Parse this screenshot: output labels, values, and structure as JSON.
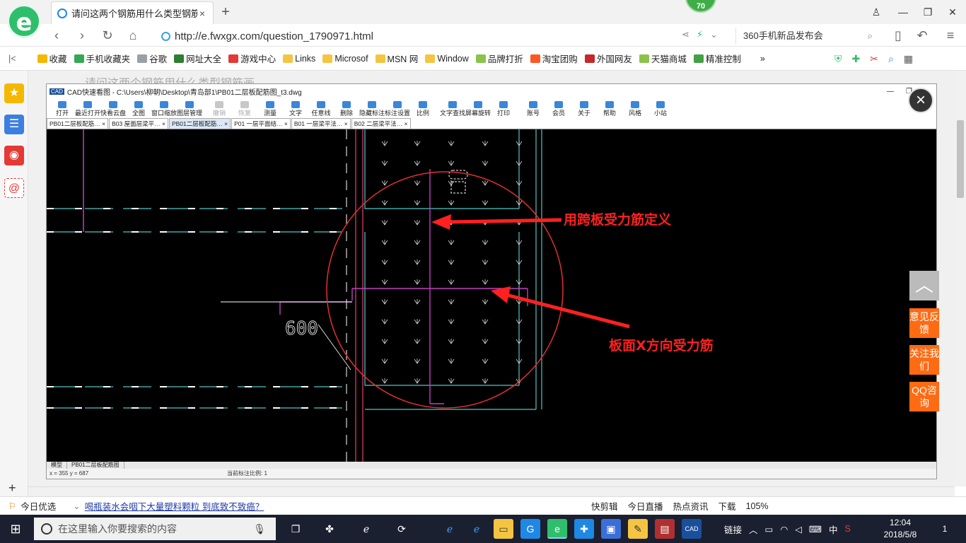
{
  "browser": {
    "logo": "e",
    "tab_title": "请问这两个钢筋用什么类型钢筋画",
    "tab_close": "×",
    "new_tab": "+",
    "badge": "70",
    "url": "http://e.fwxgx.com/question_1790971.html",
    "search_text": "360手机新品发布会",
    "bookmarks": [
      {
        "label": "收藏",
        "color": "#f5b800"
      },
      {
        "label": "手机收藏夹",
        "color": "#34a853"
      },
      {
        "label": "谷歌",
        "color": "#9aa0a6"
      },
      {
        "label": "网址大全",
        "color": "#2e7d32"
      },
      {
        "label": "游戏中心",
        "color": "#e53935"
      },
      {
        "label": "Links",
        "color": "#f4c542"
      },
      {
        "label": "Microsof",
        "color": "#f4c542"
      },
      {
        "label": "MSN 网",
        "color": "#f4c542"
      },
      {
        "label": "Window",
        "color": "#f4c542"
      },
      {
        "label": "品牌打折",
        "color": "#8bc34a"
      },
      {
        "label": "淘宝团购",
        "color": "#ff5722"
      },
      {
        "label": "外国网友",
        "color": "#c62828"
      },
      {
        "label": "天猫商城",
        "color": "#8bc34a"
      },
      {
        "label": "精准控制",
        "color": "#43a047"
      },
      {
        "label": "»",
        "color": "#ffffff"
      }
    ],
    "page_partial_text": "请问这两个钢筋用什么类型钢筋画"
  },
  "viewer": {
    "app_logo": "CAD",
    "title": "CAD快速看图 - C:\\Users\\柳朝\\Desktop\\青岛部1\\PB01二层板配筋图_t3.dwg",
    "toolbar": [
      {
        "label": "打开",
        "enabled": true
      },
      {
        "label": "最近打开",
        "enabled": true
      },
      {
        "label": "快看云盘",
        "enabled": true
      },
      {
        "label": "全图",
        "enabled": true
      },
      {
        "label": "窗口缩放",
        "enabled": true
      },
      {
        "label": "图层管理",
        "enabled": true
      },
      {
        "label": "撤销",
        "enabled": false
      },
      {
        "label": "恢复",
        "enabled": false
      },
      {
        "label": "测量",
        "enabled": true
      },
      {
        "label": "文字",
        "enabled": true
      },
      {
        "label": "任意线",
        "enabled": true
      },
      {
        "label": "删除",
        "enabled": true
      },
      {
        "label": "隐藏标注",
        "enabled": true
      },
      {
        "label": "标注设置",
        "enabled": true
      },
      {
        "label": "比例",
        "enabled": true
      },
      {
        "label": "文字查找",
        "enabled": true
      },
      {
        "label": "屏幕旋转",
        "enabled": true
      },
      {
        "label": "打印",
        "enabled": true
      },
      {
        "label": "账号",
        "enabled": true
      },
      {
        "label": "会员",
        "enabled": true
      },
      {
        "label": "关于",
        "enabled": true
      },
      {
        "label": "帮助",
        "enabled": true
      },
      {
        "label": "风格",
        "enabled": true
      },
      {
        "label": "小站",
        "enabled": true
      }
    ],
    "tabs": [
      {
        "label": "PB01二层板配筋… ×",
        "active": false
      },
      {
        "label": "B03 屋面层梁平… ×",
        "active": false
      },
      {
        "label": "PB01二层板配筋… ×",
        "active": true
      },
      {
        "label": "P01 一层平面结… ×",
        "active": false
      },
      {
        "label": "B01 一层梁平法… ×",
        "active": false
      },
      {
        "label": "B02 二层梁平法… ×",
        "active": false
      }
    ],
    "layout_tabs": [
      "模型",
      "PB01二层板配筋图"
    ],
    "status_coords": "x = 355 y = 687",
    "status_scale": "当前标注比例: 1",
    "dimension_text": "600",
    "annotation_1": "用跨板受力筋定义",
    "annotation_2": "板面X方向受力筋",
    "annotation_color": "#ff2020",
    "close_glyph": "×"
  },
  "float_buttons": {
    "top": "︿",
    "feedback": "意见反馈",
    "follow": "关注我们",
    "qq": "QQ咨询"
  },
  "newsbar": {
    "left_label": "今日优选",
    "headline": "喝瓶装水会咽下大量塑料颗粒 到底致不致癌？",
    "right_items": [
      "快剪辑",
      "今日直播",
      "热点资讯",
      "下载",
      "105%"
    ]
  },
  "taskbar": {
    "search_placeholder": "在这里输入你要搜索的内容",
    "tray_text": "链接",
    "ime": "中",
    "time": "12:04",
    "date": "2018/5/8",
    "notifications": "1"
  }
}
